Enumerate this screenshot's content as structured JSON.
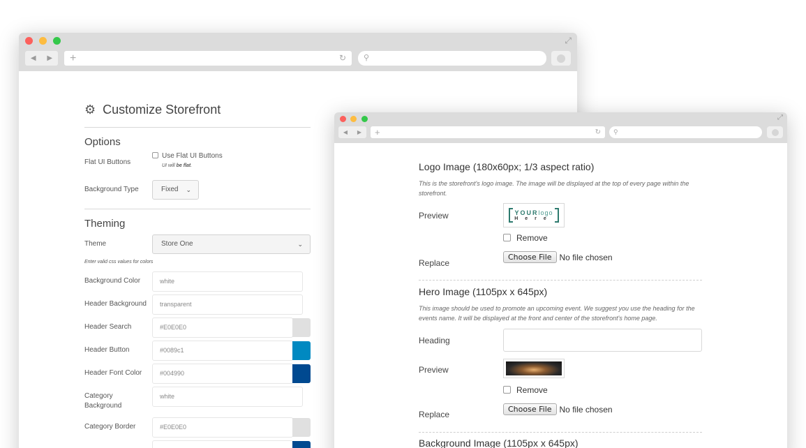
{
  "back_window": {
    "page_title": "Customize Storefront",
    "options": {
      "heading": "Options",
      "flat_ui_label": "Flat UI Buttons",
      "flat_ui_checkbox_label": "Use Flat UI Buttons",
      "flat_ui_hint_prefix": "UI will ",
      "flat_ui_hint_bold": "be flat",
      "flat_ui_hint_suffix": ".",
      "background_type_label": "Background Type",
      "background_type_value": "Fixed"
    },
    "theming": {
      "heading": "Theming",
      "theme_label": "Theme",
      "theme_value": "Store One",
      "colors_hint": "Enter valid css values for colors",
      "fields": [
        {
          "label": "Background Color",
          "value": "white",
          "swatch": ""
        },
        {
          "label": "Header Background",
          "value": "transparent",
          "swatch": ""
        },
        {
          "label": "Header Search",
          "value": "#E0E0E0",
          "swatch": "#E0E0E0"
        },
        {
          "label": "Header Button",
          "value": "#0089c1",
          "swatch": "#0089c1"
        },
        {
          "label": "Header Font Color",
          "value": "#004990",
          "swatch": "#004990"
        },
        {
          "label": "Category Background",
          "value": "white",
          "swatch": ""
        },
        {
          "label": "Category Border",
          "value": "#E0E0E0",
          "swatch": "#E0E0E0"
        }
      ]
    }
  },
  "front_window": {
    "logo": {
      "title": "Logo Image (180x60px; 1/3 aspect ratio)",
      "description": "This is the storefront's logo image. The image will be displayed at the top of every page within the storefront.",
      "preview_label": "Preview",
      "logo_text_bold": "YOUR",
      "logo_text_light": "logo",
      "logo_text_second": "Here",
      "remove_label": "Remove",
      "replace_label": "Replace",
      "choose_file_label": "Choose File",
      "no_file_text": "No file chosen"
    },
    "hero": {
      "title": "Hero Image (1105px x 645px)",
      "description": "This image should be used to promote an upcoming event. We suggest you use the heading for the events name. It will be displayed at the front and center of the storefront's home page.",
      "heading_label": "Heading",
      "heading_value": "",
      "preview_label": "Preview",
      "remove_label": "Remove",
      "replace_label": "Replace",
      "choose_file_label": "Choose File",
      "no_file_text": "No file chosen"
    },
    "background": {
      "title": "Background Image (1105px x 645px)"
    }
  }
}
